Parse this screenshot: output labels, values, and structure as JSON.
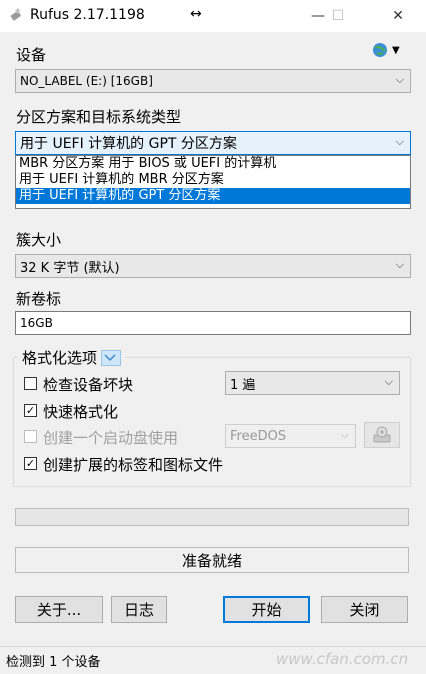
{
  "window": {
    "title": "Rufus 2.17.1198",
    "resize_glyph": "↔",
    "minimize": "—",
    "maximize": "☐",
    "close": "✕"
  },
  "device": {
    "label": "设备",
    "value": "NO_LABEL (E:) [16GB]"
  },
  "partition": {
    "label": "分区方案和目标系统类型",
    "value": "用于 UEFI 计算机的 GPT 分区方案",
    "options": [
      "MBR 分区方案 用于 BIOS 或 UEFI 的计算机",
      "用于 UEFI 计算机的 MBR 分区方案",
      "用于 UEFI 计算机的 GPT 分区方案"
    ],
    "selected_index": 2
  },
  "cluster": {
    "label": "簇大小",
    "value": "32 K 字节 (默认)"
  },
  "volume": {
    "label": "新卷标",
    "value": "16GB"
  },
  "format_options": {
    "label": "格式化选项",
    "check_bad_blocks": {
      "label": "检查设备坏块",
      "checked": false,
      "passes": "1 遍"
    },
    "quick_format": {
      "label": "快速格式化",
      "checked": true,
      "mark": "✓"
    },
    "bootable": {
      "label": "创建一个启动盘使用",
      "checked": false,
      "disabled": true,
      "image": "FreeDOS"
    },
    "extended_label": {
      "label": "创建扩展的标签和图标文件",
      "checked": true,
      "mark": "✓"
    }
  },
  "progress": 0,
  "status_text": "准备就绪",
  "buttons": {
    "about": "关于...",
    "log": "日志",
    "start": "开始",
    "close": "关闭"
  },
  "statusbar": {
    "text": "检测到 1 个设备"
  },
  "watermark": "www.cfan.com.cn",
  "colors": {
    "accent": "#0078d7"
  }
}
